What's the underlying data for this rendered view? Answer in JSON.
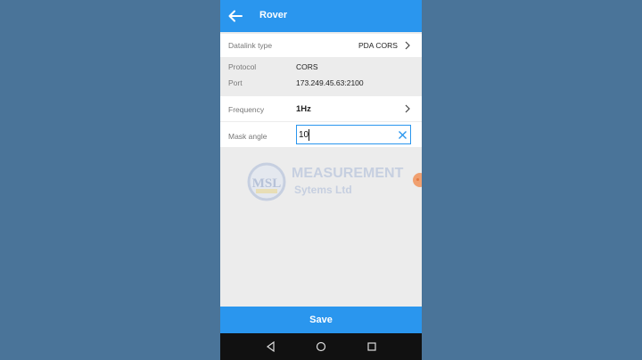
{
  "appbar": {
    "title": "Rover",
    "back_icon": "arrow-left-icon"
  },
  "datalink": {
    "label": "Datalink type",
    "value": "PDA CORS"
  },
  "protocol": {
    "label": "Protocol",
    "value": "CORS"
  },
  "port": {
    "label": "Port",
    "value": "173.249.45.63:2100"
  },
  "frequency": {
    "label": "Frequency",
    "value": "1Hz"
  },
  "mask_angle": {
    "label": "Mask angle",
    "value": "10"
  },
  "watermark": {
    "line1": "MEASUREMENT",
    "line2": "Sytems Ltd",
    "badge_text": "MSL"
  },
  "save_label": "Save",
  "navbar": {
    "back": "triangle-back-icon",
    "home": "circle-home-icon",
    "recents": "square-recents-icon"
  },
  "colors": {
    "accent": "#2a96ee",
    "backdrop": "#4a7499",
    "panel": "#ececec"
  }
}
